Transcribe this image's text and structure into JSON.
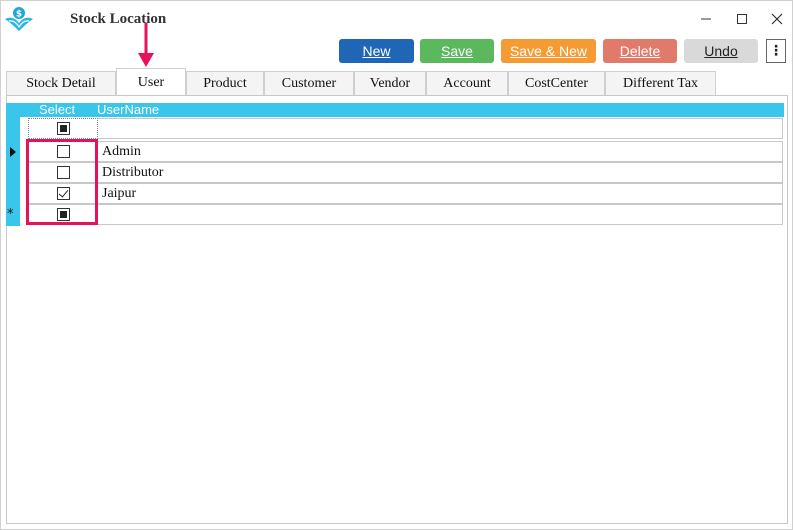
{
  "window": {
    "title": "Stock Location"
  },
  "toolbar": {
    "new_label": "New",
    "save_label": "Save",
    "save_new_label": "Save & New",
    "delete_label": "Delete",
    "undo_label": "Undo",
    "more_label": "⋮"
  },
  "tabs": [
    {
      "label": "Stock Detail"
    },
    {
      "label": "User"
    },
    {
      "label": "Product"
    },
    {
      "label": "Customer"
    },
    {
      "label": "Vendor"
    },
    {
      "label": "Account"
    },
    {
      "label": "CostCenter"
    },
    {
      "label": "Different Tax"
    }
  ],
  "active_tab": "User",
  "grid": {
    "columns": {
      "select": "Select",
      "username": "UserName"
    },
    "rows": [
      {
        "username": "Admin",
        "selected": false
      },
      {
        "username": "Distributor",
        "selected": false
      },
      {
        "username": "Jaipur",
        "selected": true
      }
    ],
    "new_row_marker": "*"
  },
  "colors": {
    "accent": "#39c6ea",
    "highlight": "#e8125b",
    "new": "#1f66b7",
    "save": "#5cb85c",
    "save_new": "#f59b33",
    "delete": "#e07a6a",
    "undo": "#d9d9d9"
  },
  "icons": {
    "logo": "app-logo-icon",
    "minimize": "minimize-icon",
    "maximize": "maximize-icon",
    "close": "close-icon",
    "arrow": "arrow-down-icon"
  }
}
